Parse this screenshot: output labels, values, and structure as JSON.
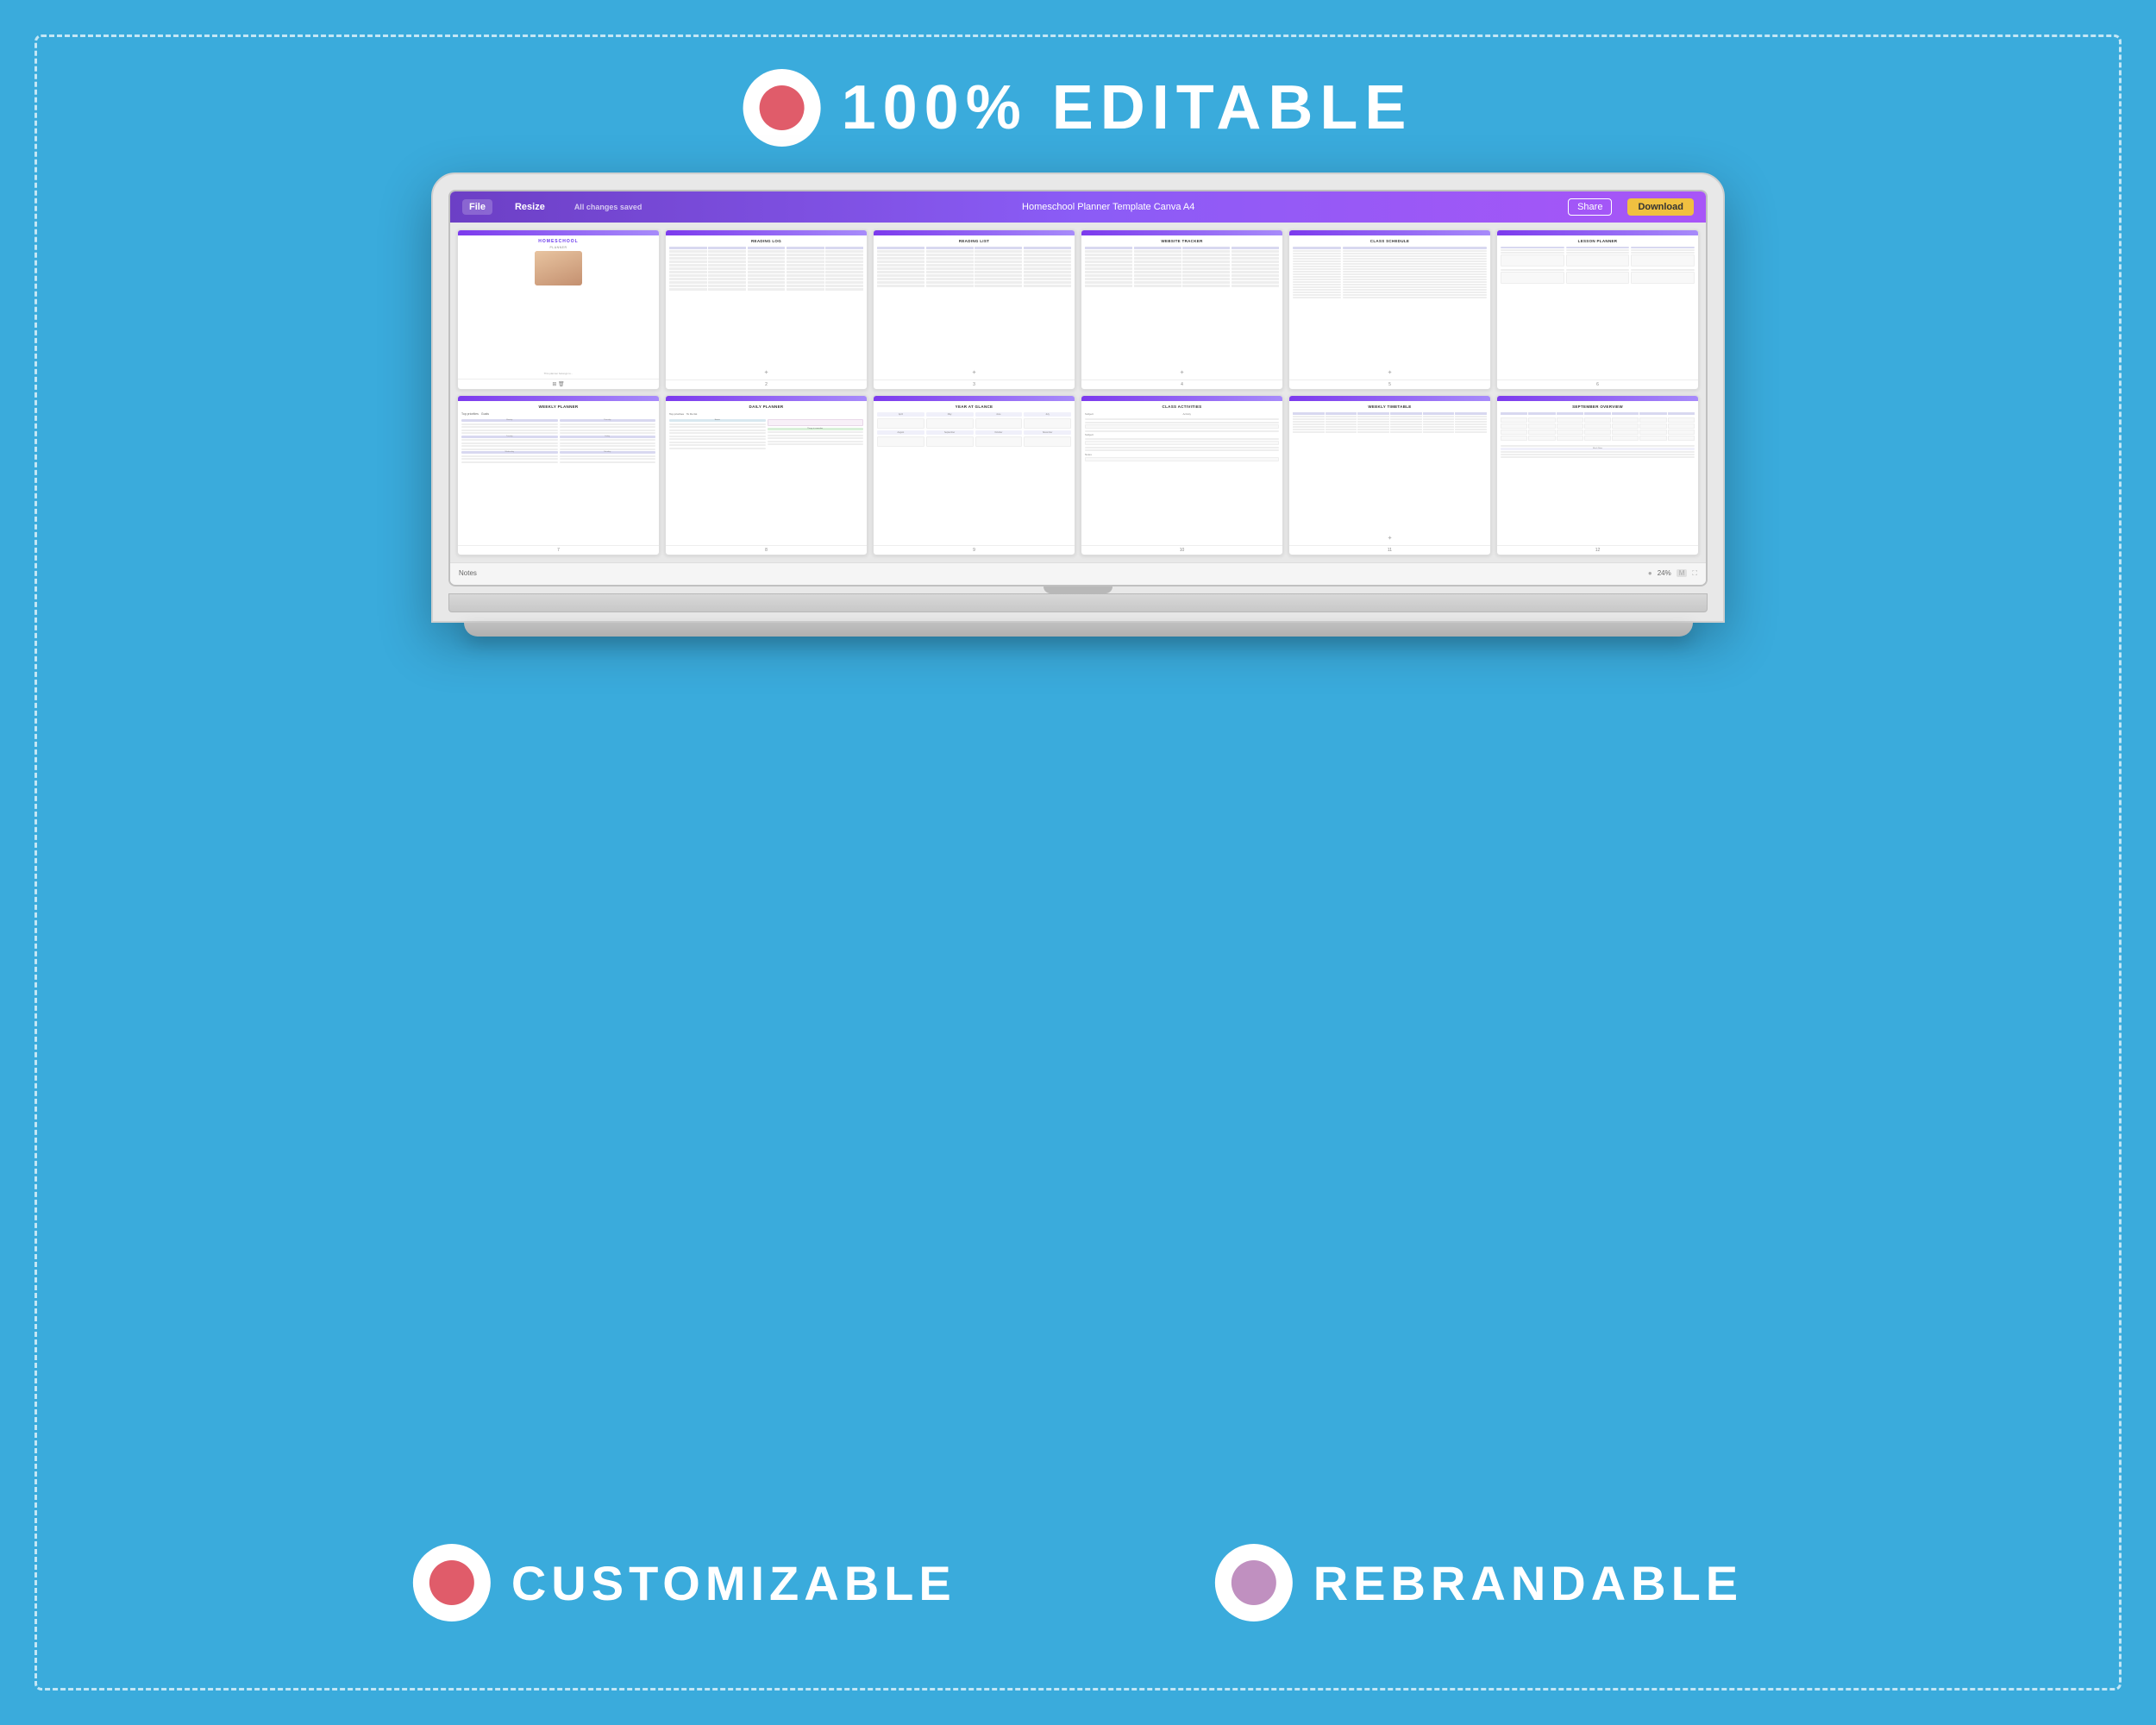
{
  "background": {
    "color": "#3aabdc"
  },
  "top_badge": {
    "text": "100% EDITABLE"
  },
  "bottom_badges": [
    {
      "text": "CUSTOMIZABLE",
      "inner_color": "#e05c6a"
    },
    {
      "text": "REBRANDABLE",
      "inner_color": "#c090c0"
    }
  ],
  "laptop": {
    "toolbar": {
      "file_label": "File",
      "resize_label": "Resize",
      "saved_label": "All changes saved",
      "title": "Homeschool Planner Template Canva A4",
      "share_label": "Share",
      "download_label": "Download"
    },
    "status_bar": {
      "notes_label": "Notes",
      "zoom": "24%"
    },
    "pages": [
      {
        "number": "",
        "title": "HOMESCHOOL PLANNER",
        "type": "cover"
      },
      {
        "number": "2",
        "title": "READING LOG",
        "type": "table"
      },
      {
        "number": "3",
        "title": "READING LIST",
        "type": "table"
      },
      {
        "number": "4",
        "title": "WEBSITE TRACKER",
        "type": "table"
      },
      {
        "number": "5",
        "title": "CLASS SCHEDULE",
        "type": "grid"
      },
      {
        "number": "6",
        "title": "LESSON PLANNER",
        "type": "table"
      },
      {
        "number": "7",
        "title": "WEEKLY PLANNER",
        "type": "week"
      },
      {
        "number": "8",
        "title": "DAILY PLANNER",
        "type": "daily"
      },
      {
        "number": "9",
        "title": "YEAR AT GLANCE",
        "type": "year"
      },
      {
        "number": "10",
        "title": "CLASS ACTIVITIES",
        "type": "activities"
      },
      {
        "number": "11",
        "title": "WEEKLY TIMETABLE",
        "type": "timetable"
      },
      {
        "number": "12",
        "title": "SEPTEMBER OVERVIEW",
        "type": "month"
      }
    ]
  }
}
